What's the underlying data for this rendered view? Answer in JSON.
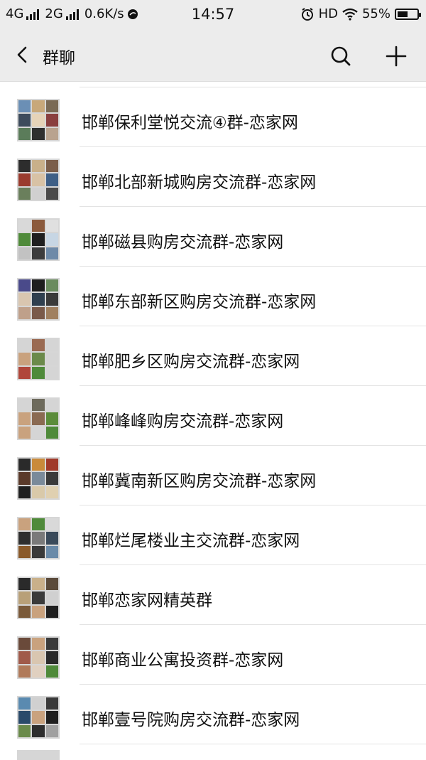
{
  "status": {
    "network1": "4G",
    "network2": "2G",
    "speed": "0.6K/s",
    "time": "14:57",
    "hd": "HD",
    "battery": "55%",
    "battery_level": 0.55
  },
  "nav": {
    "title": "群聊"
  },
  "groups": [
    {
      "name": "邯郸保利堂悦交流④群-恋家网",
      "tiles": [
        "#6b8fb5",
        "#c8a87a",
        "#7a6a55",
        "#3d4b5c",
        "#e6d3b8",
        "#8a3f3f",
        "#5b7c5a",
        "#2f2f2f",
        "#b9a38f"
      ]
    },
    {
      "name": "邯郸北部新城购房交流群-恋家网",
      "tiles": [
        "#2d2d2d",
        "#c9b08a",
        "#7b5e4a",
        "#9a3b2e",
        "#d8c2a5",
        "#3e5f86",
        "#6a7f5c",
        "#d0d0d0",
        "#4a4a4a"
      ]
    },
    {
      "name": "邯郸磁县购房交流群-恋家网",
      "tiles": [
        "#d9d9d9",
        "#8b5a3c",
        "#e0e0e0",
        "#4f8a3a",
        "#1f1f1f",
        "#c7d6e4",
        "#c2c2c2",
        "#3c3c3c",
        "#6e8aa8"
      ]
    },
    {
      "name": "邯郸东部新区购房交流群-恋家网",
      "tiles": [
        "#4a4a8a",
        "#1e1e1e",
        "#6a8b5e",
        "#d9c6b0",
        "#2f3f4f",
        "#3a3a3a",
        "#bfa08a",
        "#7a5a4a",
        "#a08060"
      ]
    },
    {
      "name": "邯郸肥乡区购房交流群-恋家网",
      "tiles": [
        "#d5d5d5",
        "#9a6a52",
        "#d5d5d5",
        "#c9a27e",
        "#6b8a4a",
        "#d5d5d5",
        "#b0463a",
        "#4f8a3a",
        "#d5d5d5"
      ]
    },
    {
      "name": "邯郸峰峰购房交流群-恋家网",
      "tiles": [
        "#d5d5d5",
        "#6d6a5c",
        "#d5d5d5",
        "#c9a27e",
        "#8a6a52",
        "#5b8c3a",
        "#c9a27e",
        "#d5d5d5",
        "#4f8a3a"
      ]
    },
    {
      "name": "邯郸冀南新区购房交流群-恋家网",
      "tiles": [
        "#2a2a2a",
        "#c98a3a",
        "#a03a2a",
        "#5a3a2a",
        "#7a8a9a",
        "#3a3a3a",
        "#1f1f1f",
        "#d9c9a9",
        "#e0d0b0"
      ]
    },
    {
      "name": "邯郸烂尾楼业主交流群-恋家网",
      "tiles": [
        "#c9a27e",
        "#4f8a3a",
        "#d9d9d9",
        "#2e2e2e",
        "#7a7a7a",
        "#3a4a5a",
        "#8a5a2a",
        "#3a3a3a",
        "#6a8aa8"
      ]
    },
    {
      "name": "邯郸恋家网精英群",
      "tiles": [
        "#2a2a2a",
        "#c9b08a",
        "#5a4a3a",
        "#b8a078",
        "#3a3a3a",
        "#d0d0d0",
        "#7a5a3a",
        "#c9a27e",
        "#1f1f1f"
      ]
    },
    {
      "name": "邯郸商业公寓投资群-恋家网",
      "tiles": [
        "#6a4a3a",
        "#c9a27e",
        "#3a3a3a",
        "#a05a4a",
        "#d9c6b0",
        "#2a2a2a",
        "#b07a5a",
        "#e0d0c0",
        "#4f8a3a"
      ]
    },
    {
      "name": "邯郸壹号院购房交流群-恋家网",
      "tiles": [
        "#5a8ab0",
        "#d0d0d0",
        "#3a3a3a",
        "#2a4a6a",
        "#c9a27e",
        "#1f1f1f",
        "#6a8a4a",
        "#2e2e2e",
        "#a0a0a0"
      ]
    }
  ]
}
